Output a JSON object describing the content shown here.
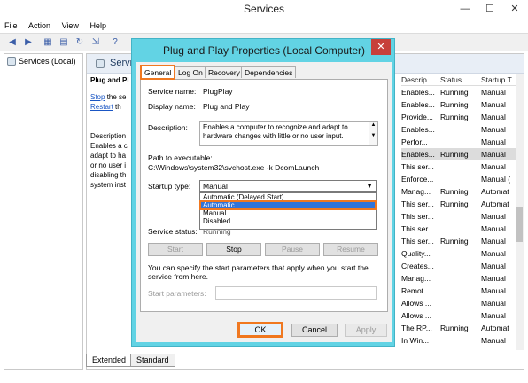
{
  "window": {
    "title": "Services",
    "minimize": "—",
    "maximize": "☐",
    "close": "✕"
  },
  "menu": [
    "File",
    "Action",
    "View",
    "Help"
  ],
  "tree": {
    "item": "Services (Local)"
  },
  "main": {
    "header": "Servi",
    "left": {
      "heading": "Plug and Pl",
      "stop_link": "Stop",
      "stop_rest": " the se",
      "restart_link": "Restart",
      "restart_rest": " th",
      "desc_lines": [
        "Description",
        "Enables a c",
        "adapt to ha",
        "or no user i",
        "disabling th",
        "system inst"
      ]
    },
    "columns": [
      "Descrip...",
      "Status",
      "Startup T"
    ],
    "rows": [
      [
        "Enables...",
        "Running",
        "Manual"
      ],
      [
        "Enables...",
        "Running",
        "Manual"
      ],
      [
        "Provide...",
        "Running",
        "Manual"
      ],
      [
        "Enables...",
        "",
        "Manual"
      ],
      [
        "Perfor...",
        "",
        "Manual"
      ],
      [
        "Enables...",
        "Running",
        "Manual"
      ],
      [
        "This ser...",
        "",
        "Manual"
      ],
      [
        "Enforce...",
        "",
        "Manual ("
      ],
      [
        "Manag...",
        "Running",
        "Automat"
      ],
      [
        "This ser...",
        "Running",
        "Automat"
      ],
      [
        "This ser...",
        "",
        "Manual"
      ],
      [
        "This ser...",
        "",
        "Manual"
      ],
      [
        "This ser...",
        "Running",
        "Manual"
      ],
      [
        "Quality...",
        "",
        "Manual"
      ],
      [
        "Creates...",
        "",
        "Manual"
      ],
      [
        "Manag...",
        "",
        "Manual"
      ],
      [
        "Remot...",
        "",
        "Manual"
      ],
      [
        "Allows ...",
        "",
        "Manual"
      ],
      [
        "Allows ...",
        "",
        "Manual"
      ],
      [
        "The RP...",
        "Running",
        "Automat"
      ],
      [
        "In Win...",
        "",
        "Manual"
      ]
    ],
    "selected_row": 5
  },
  "bottom_tabs": [
    "Extended",
    "Standard"
  ],
  "dialog": {
    "title": "Plug and Play Properties (Local Computer)",
    "close": "✕",
    "tabs": [
      "General",
      "Log On",
      "Recovery",
      "Dependencies"
    ],
    "service_name_label": "Service name:",
    "service_name": "PlugPlay",
    "display_name_label": "Display name:",
    "display_name": "Plug and Play",
    "description_label": "Description:",
    "description": "Enables a computer to recognize and adapt to hardware changes with little or no user input.",
    "path_label": "Path to executable:",
    "path": "C:\\Windows\\system32\\svchost.exe -k DcomLaunch",
    "startup_type_label": "Startup type:",
    "startup_type_value": "Manual",
    "startup_options": [
      "Automatic (Delayed Start)",
      "Automatic",
      "Manual",
      "Disabled"
    ],
    "highlighted_option": 1,
    "service_status_label": "Service status:",
    "service_status": "Running",
    "start": "Start",
    "stop": "Stop",
    "pause": "Pause",
    "resume": "Resume",
    "params_text": "You can specify the start parameters that apply when you start the service from here.",
    "start_params_label": "Start parameters:",
    "ok": "OK",
    "cancel": "Cancel",
    "apply": "Apply"
  },
  "colors": {
    "dialog_frame": "#62d3e4",
    "highlight": "#f07820",
    "selection": "#3074d9"
  }
}
